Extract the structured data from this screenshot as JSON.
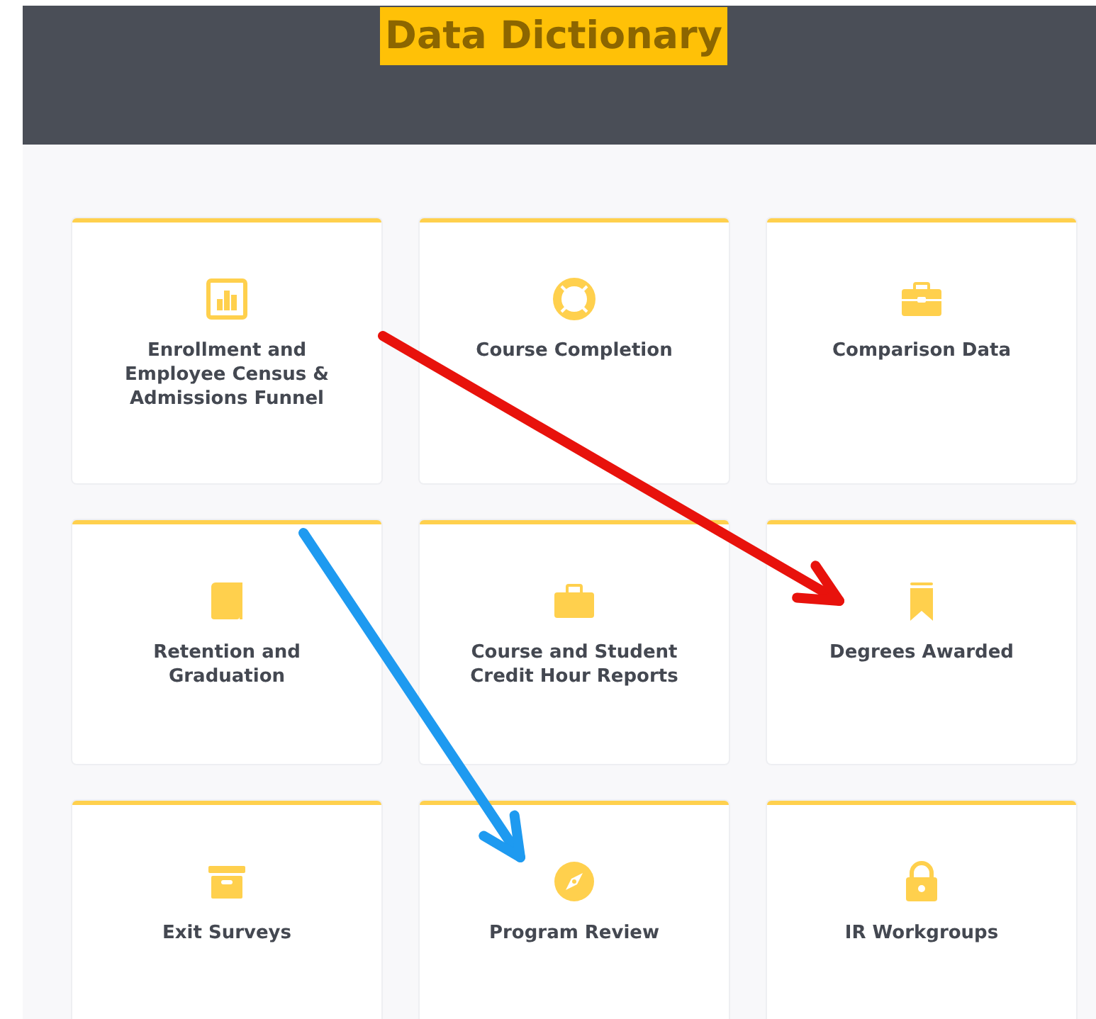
{
  "header": {
    "title": "Data Dictionary"
  },
  "cards": [
    {
      "label": "Enrollment and Employee Census & Admissions Funnel"
    },
    {
      "label": "Course Completion"
    },
    {
      "label": "Comparison Data"
    },
    {
      "label": "Retention and Graduation"
    },
    {
      "label": "Course and Student Credit Hour Reports"
    },
    {
      "label": "Degrees Awarded"
    },
    {
      "label": "Exit Surveys"
    },
    {
      "label": "Program Review"
    },
    {
      "label": "IR Workgroups"
    }
  ],
  "annotations": [
    {
      "kind": "arrow",
      "color": "#e8120c"
    },
    {
      "kind": "arrow",
      "color": "#1e9af0"
    }
  ]
}
